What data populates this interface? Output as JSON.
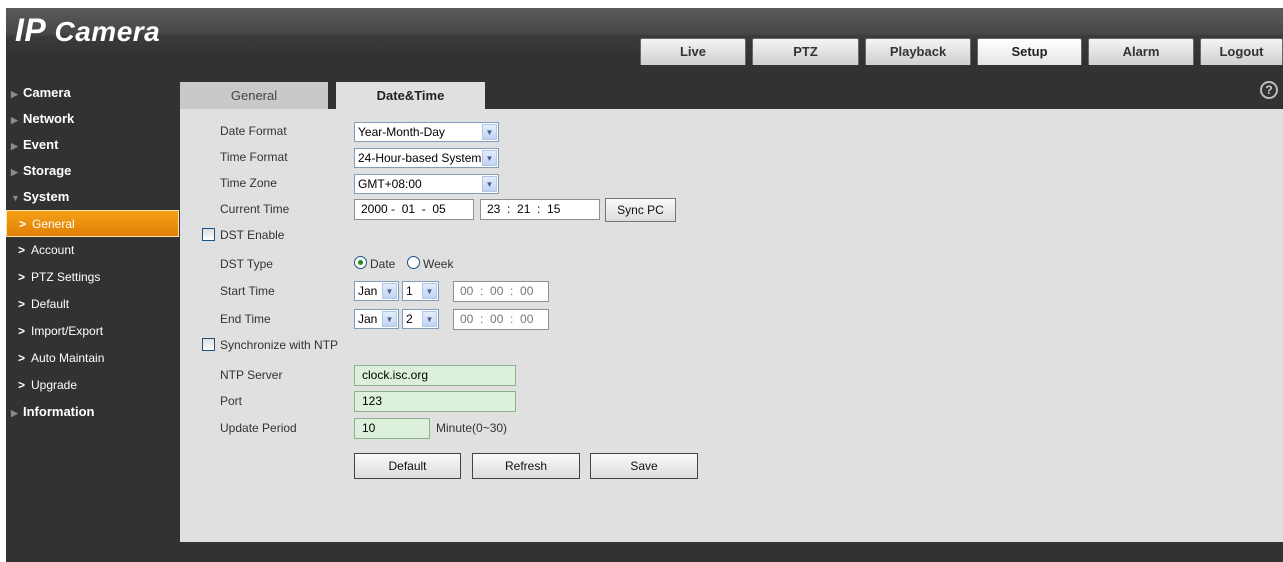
{
  "header": {
    "logo_prefix": "IP",
    "logo_suffix": "Camera",
    "tabs": [
      {
        "label": "Live"
      },
      {
        "label": "PTZ"
      },
      {
        "label": "Playback"
      },
      {
        "label": "Setup"
      },
      {
        "label": "Alarm"
      },
      {
        "label": "Logout"
      }
    ],
    "active_tab": "Setup"
  },
  "sidebar": {
    "sections": [
      {
        "label": "Camera"
      },
      {
        "label": "Network"
      },
      {
        "label": "Event"
      },
      {
        "label": "Storage"
      },
      {
        "label": "System"
      },
      {
        "label": "Information"
      }
    ],
    "system_items": [
      {
        "label": "General"
      },
      {
        "label": "Account"
      },
      {
        "label": "PTZ Settings"
      },
      {
        "label": "Default"
      },
      {
        "label": "Import/Export"
      },
      {
        "label": "Auto Maintain"
      },
      {
        "label": "Upgrade"
      }
    ],
    "active_item": "General",
    "accent_color": "#f39a12"
  },
  "subtabs": {
    "general": "General",
    "datetime": "Date&Time",
    "active": "Date&Time",
    "help": "?"
  },
  "form": {
    "date_format": {
      "label": "Date Format",
      "value": "Year-Month-Day"
    },
    "time_format": {
      "label": "Time Format",
      "value": "24-Hour-based System"
    },
    "time_zone": {
      "label": "Time Zone",
      "value": "GMT+08:00"
    },
    "current_time": {
      "label": "Current Time",
      "date": "2000 -  01  -  05",
      "time": "23  :  21  :  15",
      "sync_button": "Sync PC"
    },
    "dst_enable": {
      "label": "DST Enable",
      "checked": false
    },
    "dst_type": {
      "label": "DST Type",
      "options": [
        "Date",
        "Week"
      ],
      "selected": "Date"
    },
    "start_time": {
      "label": "Start Time",
      "month": "Jan",
      "day": "1",
      "time": "00  :  00  :  00"
    },
    "end_time": {
      "label": "End Time",
      "month": "Jan",
      "day": "2",
      "time": "00  :  00  :  00"
    },
    "ntp_sync": {
      "label": "Synchronize with NTP",
      "checked": false
    },
    "ntp_server": {
      "label": "NTP Server",
      "value": "clock.isc.org"
    },
    "port": {
      "label": "Port",
      "value": "123"
    },
    "update_period": {
      "label": "Update Period",
      "value": "10",
      "unit": "Minute(0~30)"
    },
    "buttons": {
      "default": "Default",
      "refresh": "Refresh",
      "save": "Save"
    }
  }
}
